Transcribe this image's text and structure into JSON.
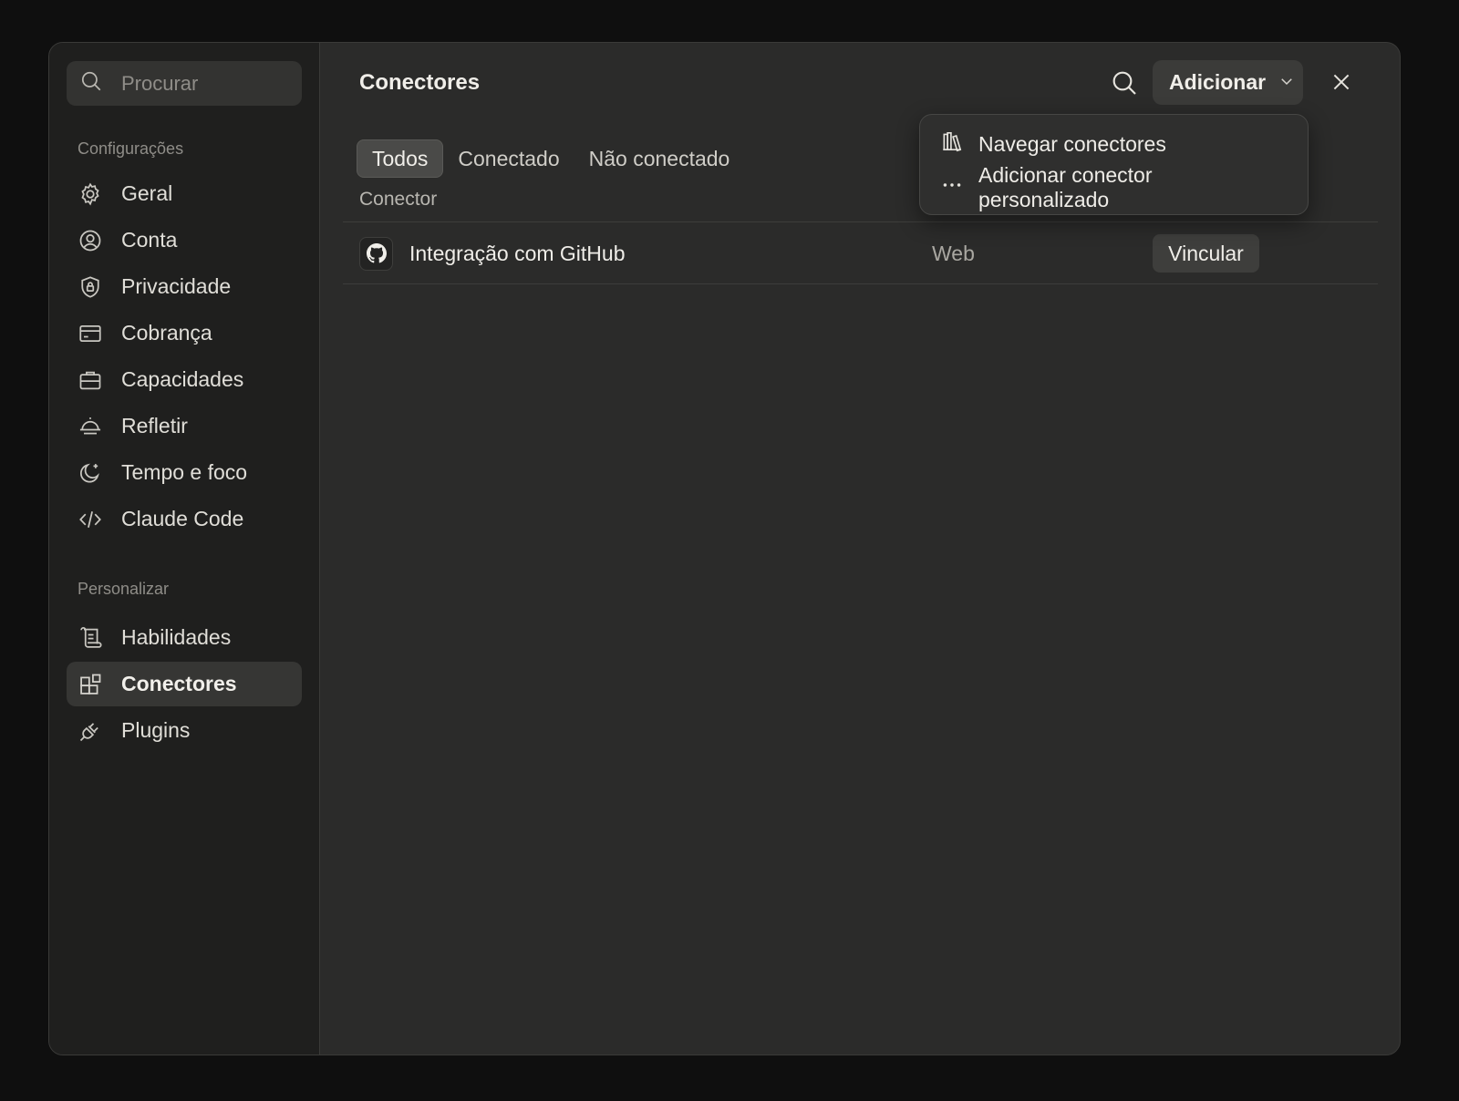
{
  "sidebar": {
    "search_placeholder": "Procurar",
    "section_settings": "Configurações",
    "section_customize": "Personalizar",
    "items": [
      {
        "label": "Geral",
        "icon": "gear-icon"
      },
      {
        "label": "Conta",
        "icon": "user-circle-icon"
      },
      {
        "label": "Privacidade",
        "icon": "shield-lock-icon"
      },
      {
        "label": "Cobrança",
        "icon": "credit-card-icon"
      },
      {
        "label": "Capacidades",
        "icon": "briefcase-icon"
      },
      {
        "label": "Refletir",
        "icon": "sunrise-icon"
      },
      {
        "label": "Tempo e foco",
        "icon": "moon-icon"
      },
      {
        "label": "Claude Code",
        "icon": "code-icon"
      }
    ],
    "custom_items": [
      {
        "label": "Habilidades",
        "icon": "scroll-icon"
      },
      {
        "label": "Conectores",
        "icon": "grid-plus-icon",
        "active": true
      },
      {
        "label": "Plugins",
        "icon": "plug-icon"
      }
    ]
  },
  "header": {
    "title": "Conectores",
    "add_label": "Adicionar"
  },
  "tabs": [
    {
      "label": "Todos",
      "active": true
    },
    {
      "label": "Conectado"
    },
    {
      "label": "Não conectado"
    }
  ],
  "table": {
    "column_header": "Conector",
    "rows": [
      {
        "name": "Integração com GitHub",
        "type": "Web",
        "action": "Vincular",
        "icon": "github-icon"
      }
    ]
  },
  "dropdown": {
    "items": [
      {
        "label": "Navegar conectores",
        "icon": "library-icon"
      },
      {
        "label": "Adicionar conector personalizado",
        "icon": "ellipsis-icon"
      }
    ]
  }
}
